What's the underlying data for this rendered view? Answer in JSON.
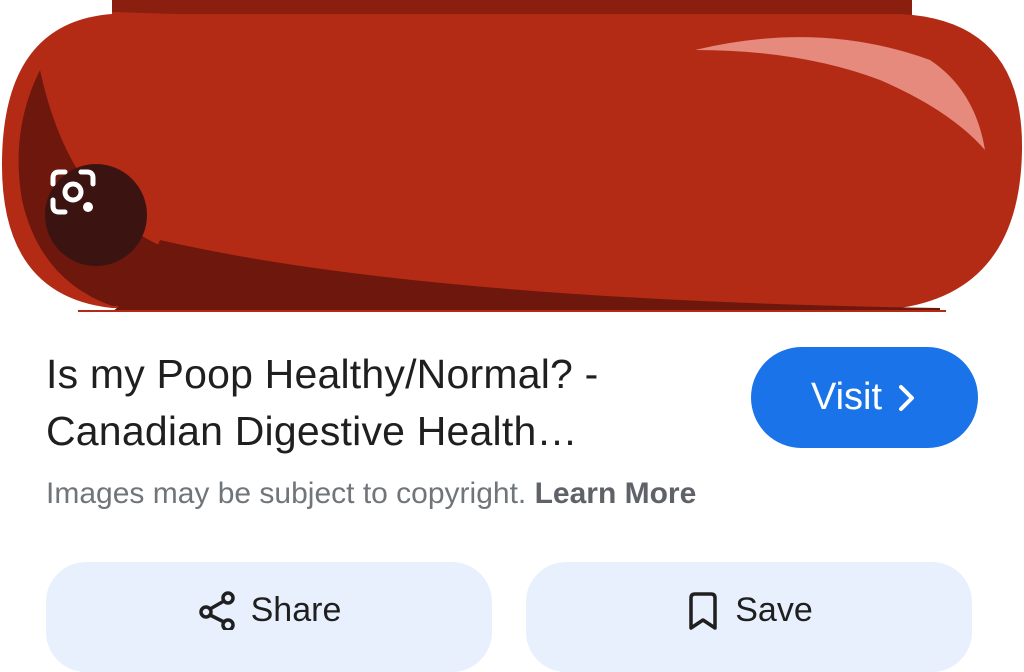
{
  "image": {
    "alt_icon": "red-pill-capsule-image",
    "colors": {
      "body": "#b32b15",
      "shadow": "#6e170d",
      "highlight": "#e58a7c"
    }
  },
  "lens": {
    "icon": "google-lens-icon"
  },
  "result": {
    "title_line1": "Is my Poop Healthy/Normal? -",
    "title_line2": "Canadian Digestive Health…"
  },
  "visit_button": {
    "label": "Visit",
    "icon": "chevron-right-icon",
    "color": "#1a73e8"
  },
  "copyright": {
    "text": "Images may be subject to copyright.",
    "link": "Learn More"
  },
  "actions": {
    "share_label": "Share",
    "share_icon": "share-icon",
    "save_label": "Save",
    "save_icon": "bookmark-icon",
    "background": "#e8f0fe"
  }
}
